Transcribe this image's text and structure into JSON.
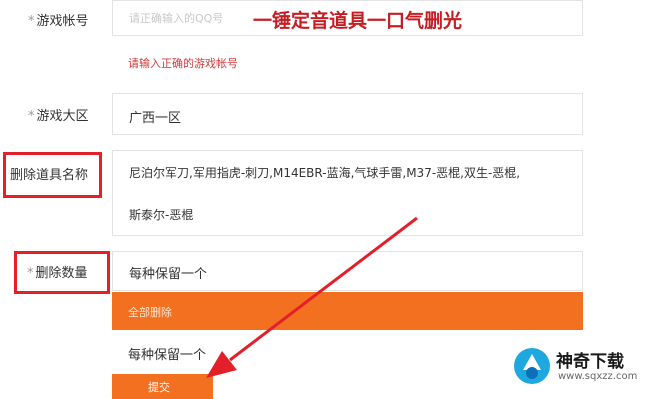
{
  "form": {
    "account_label": "游戏帐号",
    "account_placeholder": "请正确输入的QQ号",
    "account_error": "请输入正确的游戏帐号",
    "region_label": "游戏大区",
    "region_value": "广西一区",
    "item_name_label": "删除道具名称",
    "item_names_line1": "尼泊尔军刀,军用指虎-刺刀,M14EBR-蓝海,气球手雷,M37-恶棍,双生-恶棍,",
    "item_names_line2": "斯泰尔-恶棍",
    "quantity_label": "删除数量",
    "quantity_selected": "每种保留一个",
    "dropdown_options": [
      "全部删除",
      "每种保留一个"
    ],
    "submit_label": "提交"
  },
  "overlay": {
    "banner": "一锤定音道具一口气删光",
    "highlight_color": "#e1202a",
    "accent_color": "#f37021"
  },
  "watermark": {
    "name": "神奇下载",
    "url": "www.sqxzz.com"
  }
}
